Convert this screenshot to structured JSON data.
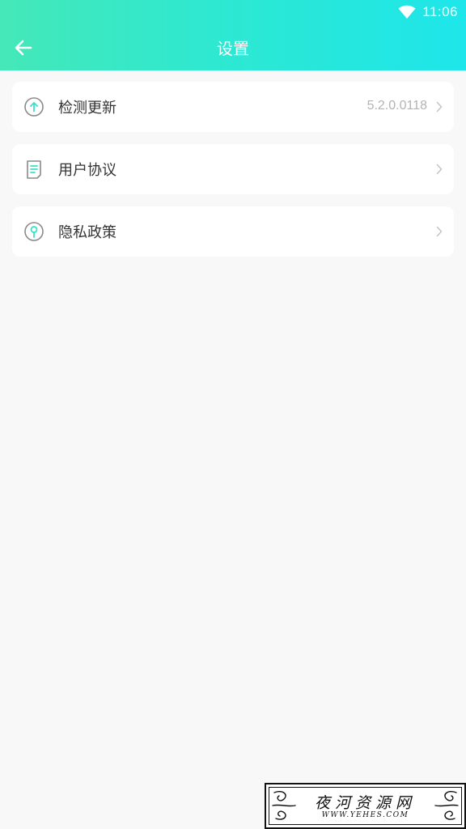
{
  "status_bar": {
    "time": "11:06"
  },
  "header": {
    "title": "设置"
  },
  "settings": {
    "items": [
      {
        "label": "检测更新",
        "value": "5.2.0.0118",
        "icon": "upload-circle-icon"
      },
      {
        "label": "用户协议",
        "value": "",
        "icon": "document-icon"
      },
      {
        "label": "隐私政策",
        "value": "",
        "icon": "privacy-key-icon"
      }
    ]
  },
  "watermark": {
    "title": "夜河资源网",
    "url": "WWW.YEHES.COM"
  },
  "colors": {
    "header_start": "#45e8b8",
    "header_end": "#1ee6ea",
    "icon_accent": "#3ddfc8",
    "background": "#f8f8f8"
  }
}
